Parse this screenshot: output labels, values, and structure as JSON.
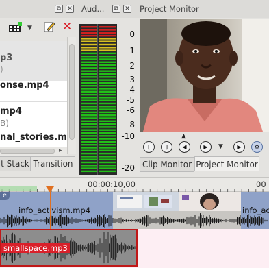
{
  "left_panel": {
    "clips": [
      {
        "name": "p3",
        "sub": ")"
      },
      {
        "name": "onse.mp4",
        "sub": ""
      },
      {
        "name": "mp4",
        "sub": "B)"
      },
      {
        "name": "nal_stories.m",
        "sub": ""
      }
    ],
    "tabs": [
      "t Stack",
      "Transition"
    ]
  },
  "audio_panel": {
    "title": "Aud...",
    "scale": [
      "0",
      "-1",
      "-2",
      "-3",
      "-4",
      "-5",
      "-6",
      "-8",
      "-10",
      "-20"
    ]
  },
  "monitor": {
    "title": "Project Monitor",
    "tabs": [
      "Clip Monitor",
      "Project Monitor"
    ]
  },
  "timeline": {
    "timecode": "00:00:10,00",
    "timecode2": "00",
    "video_clips": [
      "info_activism.mp4",
      "info_act"
    ],
    "audio_clip": "smallspace.mp3",
    "track_label": "e"
  },
  "colors": {
    "accent_red": "#d9202a",
    "video_track": "#8fa2c8",
    "playhead": "#e07020",
    "meter_green": "#22c018",
    "meter_yellow": "#d8c020",
    "meter_red": "#d02020"
  }
}
